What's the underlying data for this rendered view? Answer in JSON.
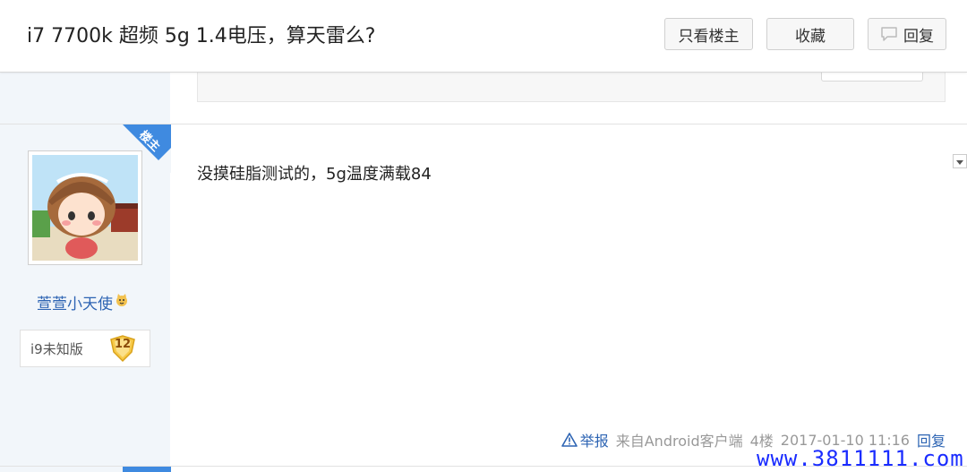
{
  "header": {
    "title": "i7 7700k 超频 5g 1.4电压，算天雷么?",
    "only_louzhu_label": "只看楼主",
    "favorite_label": "收藏",
    "reply_label": "回复"
  },
  "post": {
    "badge_label": "楼主",
    "author": {
      "username": "萱萱小天使",
      "level_name": "i9未知版",
      "level_number": "12"
    },
    "content": "没摸硅脂测试的，5g温度满载84",
    "meta": {
      "report_label": "举报",
      "source": "来自Android客户端",
      "floor": "4楼",
      "timestamp": "2017-01-10 11:16",
      "reply_label": "回复"
    }
  },
  "watermark": "www.3811111.com",
  "colors": {
    "link_blue": "#2d64b3",
    "badge_blue": "#3f8ae0",
    "watermark_blue": "#1a2cff",
    "sidebar_bg": "#f2f6fa"
  }
}
